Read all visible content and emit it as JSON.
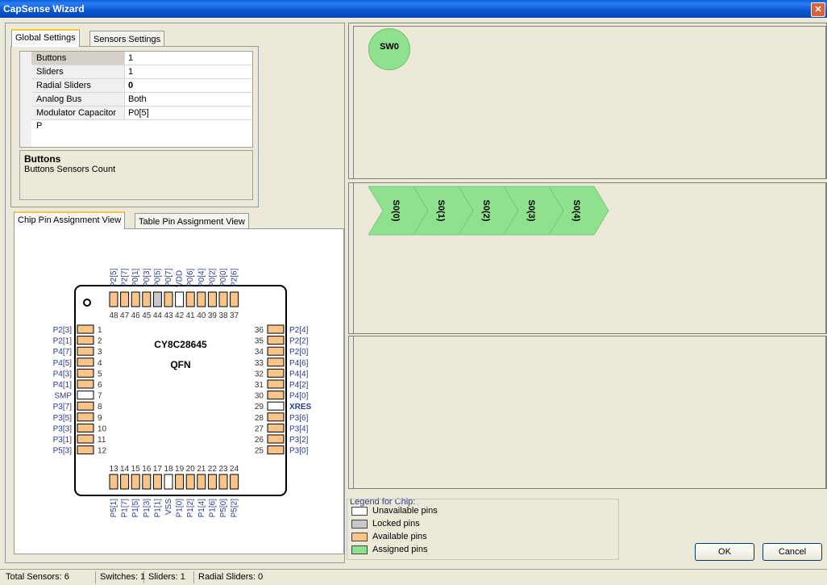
{
  "window": {
    "title": "CapSense Wizard",
    "close_glyph": "✕"
  },
  "top_tabs": [
    "Global Settings",
    "Sensors Settings"
  ],
  "properties": [
    {
      "name": "Buttons",
      "value": "1",
      "bold": false
    },
    {
      "name": "Sliders",
      "value": "1",
      "bold": false
    },
    {
      "name": "Radial Sliders",
      "value": "0",
      "bold": true
    },
    {
      "name": "Analog Bus",
      "value": "Both",
      "bold": false
    },
    {
      "name": "Modulator Capacitor P",
      "value": "P0[5]",
      "bold": false
    }
  ],
  "help": {
    "title": "Buttons",
    "text": "Buttons Sensors Count"
  },
  "bottom_tabs": [
    "Chip Pin Assignment View",
    "Table Pin Assignment View"
  ],
  "chip": {
    "name": "CY8C28645",
    "package": "QFN",
    "top_pins": [
      "P2[5]",
      "P2[7]",
      "P0[1]",
      "P0[3]",
      "P0[5]",
      "P0[7]",
      "VDD",
      "P0[6]",
      "P0[4]",
      "P0[2]",
      "P0[0]",
      "P2[6]"
    ],
    "top_nums": [
      "48",
      "47",
      "46",
      "45",
      "44",
      "43",
      "42",
      "41",
      "40",
      "39",
      "38",
      "37"
    ],
    "top_states": [
      "avail",
      "avail",
      "avail",
      "avail",
      "locked",
      "avail",
      "unavail",
      "avail",
      "avail",
      "avail",
      "avail",
      "avail"
    ],
    "left_pins": [
      "P2[3]",
      "P2[1]",
      "P4[7]",
      "P4[5]",
      "P4[3]",
      "P4[1]",
      "SMP",
      "P3[7]",
      "P3[5]",
      "P3[3]",
      "P3[1]",
      "P5[3]"
    ],
    "left_nums": [
      "1",
      "2",
      "3",
      "4",
      "5",
      "6",
      "7",
      "8",
      "9",
      "10",
      "11",
      "12"
    ],
    "left_states": [
      "avail",
      "avail",
      "avail",
      "avail",
      "avail",
      "avail",
      "unavail",
      "avail",
      "avail",
      "avail",
      "avail",
      "avail"
    ],
    "right_pins": [
      "P2[4]",
      "P2[2]",
      "P2[0]",
      "P4[6]",
      "P4[4]",
      "P4[2]",
      "P4[0]",
      "XRES",
      "P3[6]",
      "P3[4]",
      "P3[2]",
      "P3[0]"
    ],
    "right_nums": [
      "36",
      "35",
      "34",
      "33",
      "32",
      "31",
      "30",
      "29",
      "28",
      "27",
      "26",
      "25"
    ],
    "right_states": [
      "avail",
      "avail",
      "avail",
      "avail",
      "avail",
      "avail",
      "avail",
      "unavail",
      "avail",
      "avail",
      "avail",
      "avail"
    ],
    "bottom_pins": [
      "P5[1]",
      "P1[7]",
      "P1[5]",
      "P1[3]",
      "P1[1]",
      "VSS",
      "P1[0]",
      "P1[2]",
      "P1[4]",
      "P1[6]",
      "P5[0]",
      "P5[2]"
    ],
    "bottom_nums": [
      "13",
      "14",
      "15",
      "16",
      "17",
      "18",
      "19",
      "20",
      "21",
      "22",
      "23",
      "24"
    ],
    "bottom_states": [
      "avail",
      "avail",
      "avail",
      "avail",
      "avail",
      "unavail",
      "avail",
      "avail",
      "avail",
      "avail",
      "avail",
      "avail"
    ]
  },
  "buttons_pane": {
    "button_label": "SW0"
  },
  "slider_pane": {
    "segments": [
      "S0(0)",
      "S0(1)",
      "S0(2)",
      "S0(3)",
      "S0(4)"
    ]
  },
  "legend": {
    "title": "Legend for Chip:",
    "items": [
      {
        "label": "Unavailable pins",
        "color": "#ffffff"
      },
      {
        "label": "Locked pins",
        "color": "#c8c8c8"
      },
      {
        "label": "Available pins",
        "color": "#f7c48a"
      },
      {
        "label": "Assigned pins",
        "color": "#8fe08f"
      }
    ]
  },
  "actions": {
    "ok": "OK",
    "cancel": "Cancel"
  },
  "status": [
    "Total Sensors: 6",
    "Switches: 1",
    "Sliders: 1",
    "Radial Sliders: 0"
  ],
  "colors": {
    "avail": "#f7c48a",
    "locked": "#c8c8c8",
    "unavail": "#ffffff",
    "assigned": "#8fe08f",
    "pin_label": "#2b3b8f"
  }
}
